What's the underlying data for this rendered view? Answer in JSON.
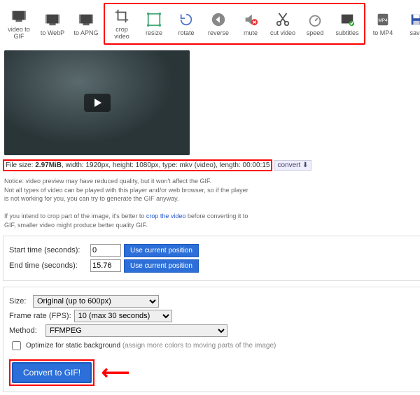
{
  "toolbar": {
    "items": [
      {
        "label": "video to GIF"
      },
      {
        "label": "to WebP"
      },
      {
        "label": "to APNG"
      },
      {
        "label": "crop video"
      },
      {
        "label": "resize"
      },
      {
        "label": "rotate"
      },
      {
        "label": "reverse"
      },
      {
        "label": "mute"
      },
      {
        "label": "cut video"
      },
      {
        "label": "speed"
      },
      {
        "label": "subtitles"
      },
      {
        "label": "to MP4"
      },
      {
        "label": "save"
      }
    ]
  },
  "fileinfo": {
    "prefix": "File size: ",
    "size": "2.97MiB",
    "rest": ", width: 1920px, height: 1080px, type: mkv (video), length: 00:00:15",
    "convert": "convert"
  },
  "notice": {
    "p1a": "Notice: video preview may have reduced quality, but it won't affect the GIF.",
    "p1b": "Not all types of video can be played with this player and/or web browser, so if the player",
    "p1c": "is not working for you, you can try to generate the GIF anyway.",
    "p2a": "If you intend to crop part of the image, it's better to ",
    "p2link": "crop the video",
    "p2b": " before converting it to",
    "p2c": "GIF, smaller video might produce better quality GIF."
  },
  "times": {
    "start_label": "Start time (seconds):",
    "start_val": "0",
    "end_label": "End time (seconds):",
    "end_val": "15.76",
    "use": "Use current position"
  },
  "opts": {
    "size_label": "Size:",
    "size_val": "Original (up to 600px)",
    "fps_label": "Frame rate (FPS):",
    "fps_val": "10 (max 30 seconds)",
    "method_label": "Method:",
    "method_val": "FFMPEG",
    "optimize": "Optimize for static background ",
    "optimize_sub": "(assign more colors to moving parts of the image)"
  },
  "convert": "Convert to GIF!"
}
